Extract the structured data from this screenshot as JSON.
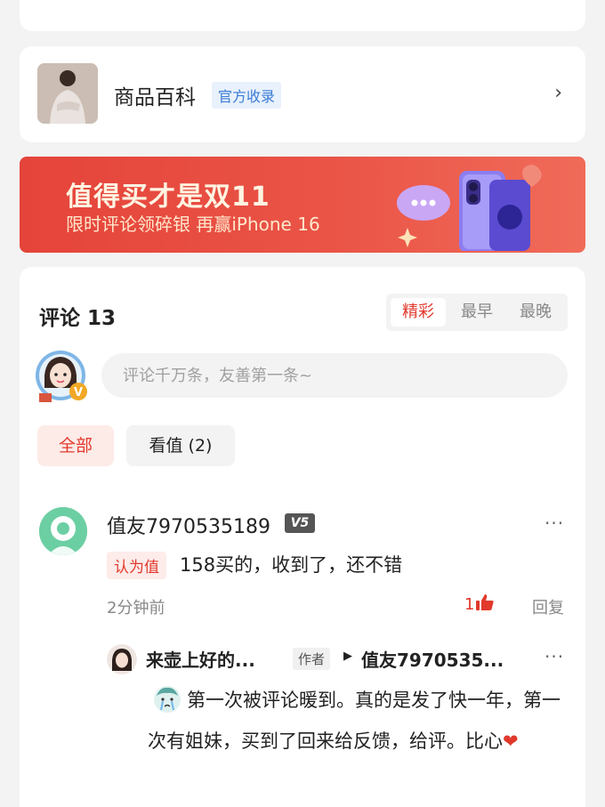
{
  "wiki": {
    "title": "商品百科",
    "badge": "官方收录",
    "chevron": "›",
    "thumb_icon": "product-thumbnail"
  },
  "banner": {
    "title": "值得买才是双11",
    "subtitle": "限时评论领碎银 再赢iPhone 16",
    "art_icon": "phone-gift-illustration"
  },
  "comments": {
    "title": "评论 13",
    "sort_tabs": [
      {
        "label": "精彩",
        "active": true
      },
      {
        "label": "最早",
        "active": false
      },
      {
        "label": "最晚",
        "active": false
      }
    ],
    "input_placeholder": "评论千万条，友善第一条~",
    "filters": [
      {
        "label": "全部",
        "active": true
      },
      {
        "label": "看值 (2)",
        "active": false
      }
    ],
    "items": [
      {
        "user": "值友7970535189",
        "level": "V5",
        "tag": "认为值",
        "text": "158买的，收到了，还不错",
        "time": "2分钟前",
        "likes": "1",
        "reply_label": "回复",
        "more": "···",
        "reply": {
          "user": "来壶上好的...",
          "author_tag": "作者",
          "arrow": "▶",
          "target": "值友7970535...",
          "text": "第一次被评论暖到。真的是发了快一年，第一次有姐妹，买到了回来给反馈，给评。比心",
          "heart": "❤",
          "more": "···"
        }
      }
    ]
  },
  "colors": {
    "accent": "#e1392c",
    "banner_red": "#e5443a",
    "avatar_green": "#6ccfa3",
    "link_blue": "#3a7bd5"
  }
}
